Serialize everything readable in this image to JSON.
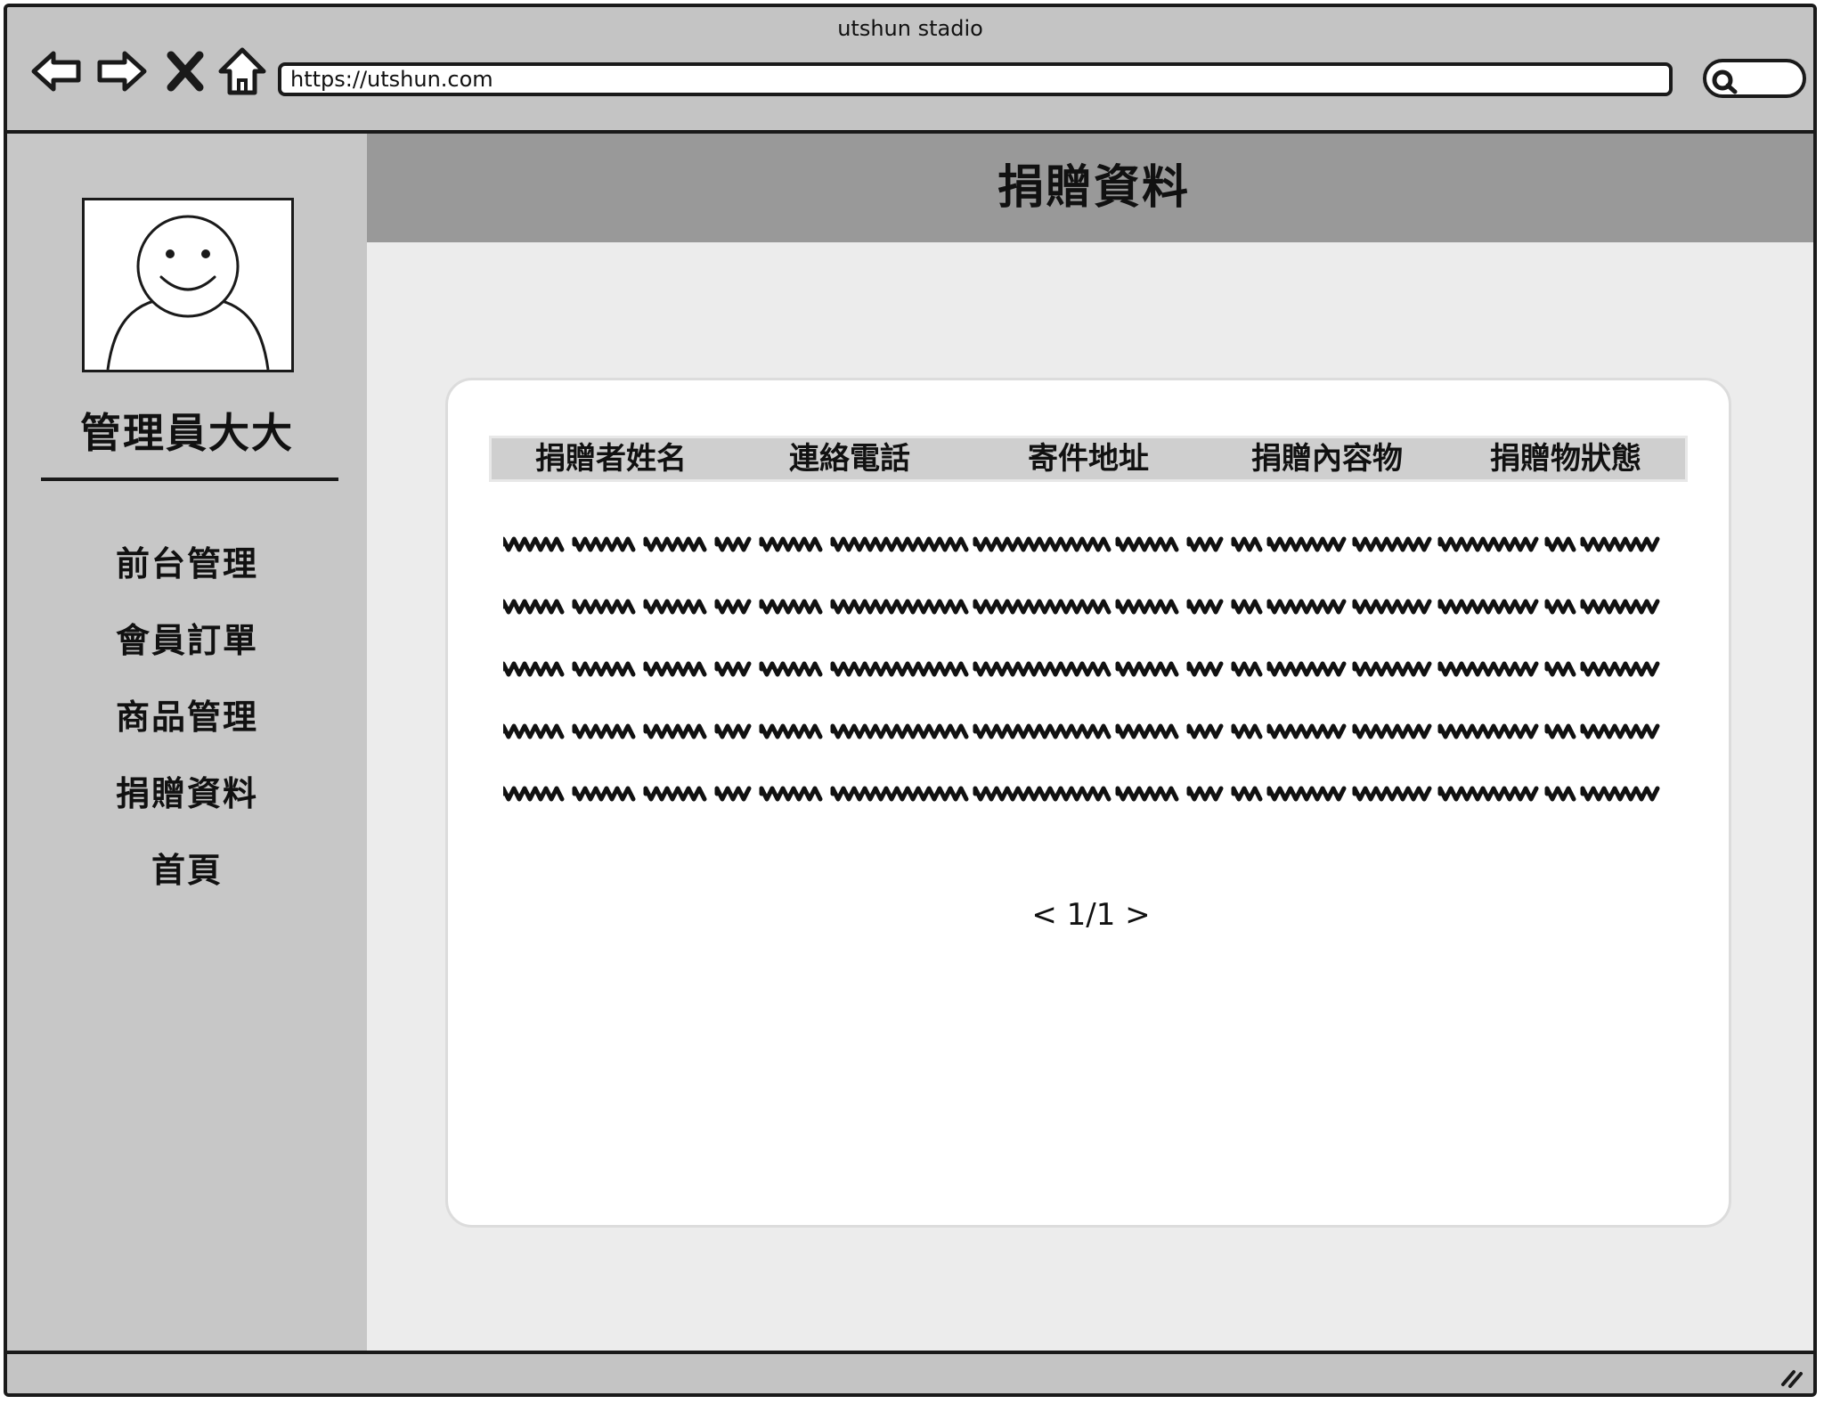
{
  "window": {
    "title": "utshun stadio"
  },
  "browser": {
    "url": "https://utshun.com",
    "icons": [
      "back-arrow-icon",
      "forward-arrow-icon",
      "close-icon",
      "home-icon",
      "search-icon"
    ]
  },
  "sidebar": {
    "username": "管理員大大",
    "items": [
      {
        "label": "前台管理"
      },
      {
        "label": "會員訂單"
      },
      {
        "label": "商品管理"
      },
      {
        "label": "捐贈資料"
      },
      {
        "label": "首頁"
      }
    ]
  },
  "main": {
    "title": "捐贈資料",
    "table": {
      "columns": [
        "捐贈者姓名",
        "連絡電話",
        "寄件地址",
        "捐贈內容物",
        "捐贈物狀態"
      ],
      "row_count": 5
    },
    "pager": {
      "prev": "<",
      "current": "1/1",
      "next": ">"
    }
  },
  "colors": {
    "chrome": "#c4c4c4",
    "sidebar": "#c7c7c7",
    "header": "#999999",
    "content_bg": "#ececec",
    "table_head": "#cfcfcf",
    "ink": "#1a1a1a"
  }
}
